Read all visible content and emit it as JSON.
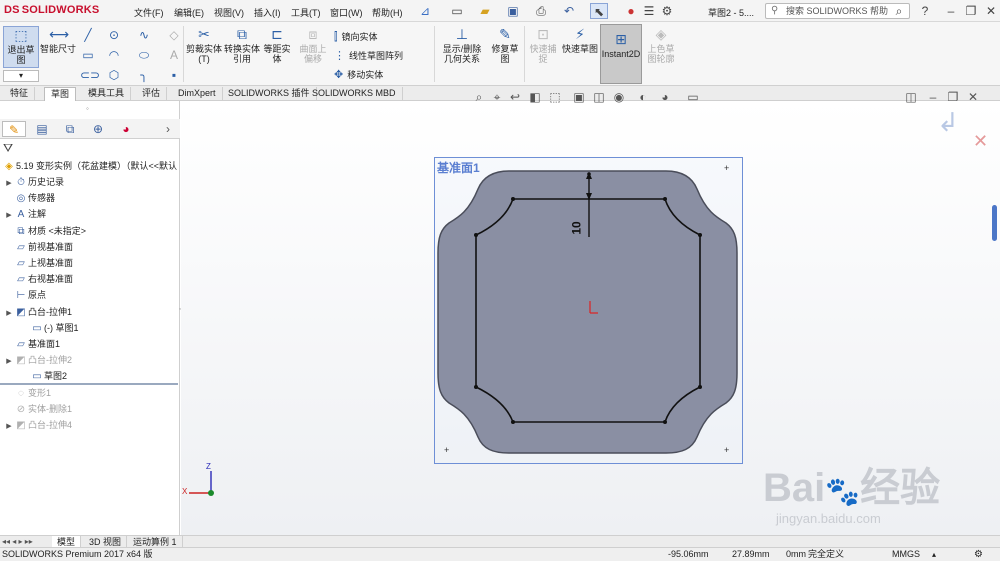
{
  "app": {
    "logo": "SOLIDWORKS",
    "logo_mark": "DS",
    "window_title": "草图2 - 5....",
    "search_placeholder": "搜索 SOLIDWORKS 帮助"
  },
  "menu": [
    "文件(F)",
    "编辑(E)",
    "视图(V)",
    "插入(I)",
    "工具(T)",
    "窗口(W)",
    "帮助(H)"
  ],
  "toolbar": {
    "exit_sketch": "退出草图",
    "smart_dim": "智能尺寸",
    "trim": "剪裁实体(T)",
    "convert": "转换实体引用",
    "offset": "等距实体",
    "surface_offset": "曲面上偏移",
    "mirror": "镜向实体",
    "linear_pattern": "线性草图阵列",
    "move": "移动实体",
    "display_delete": "显示/删除几何关系",
    "repair": "修复草图",
    "quick_snap": "快速捕捉",
    "rapid_sketch": "快速草图",
    "instant2d": "Instant2D",
    "shaded_contours": "上色草图轮廓"
  },
  "tabs": [
    "特征",
    "草图",
    "模具工具",
    "评估",
    "DimXpert",
    "SOLIDWORKS 插件",
    "SOLIDWORKS MBD"
  ],
  "active_tab": "草图",
  "feature_tree": {
    "root": "5.19 变形实例（花盆建模）（默认<<默认",
    "items": [
      {
        "label": "历史记录",
        "icon": "history-icon",
        "arrow": true,
        "indent": 0,
        "grey": false
      },
      {
        "label": "传感器",
        "icon": "sensor-icon",
        "arrow": false,
        "indent": 0,
        "grey": false
      },
      {
        "label": "注解",
        "icon": "annotation-icon",
        "arrow": true,
        "indent": 0,
        "grey": false
      },
      {
        "label": "材质 <未指定>",
        "icon": "material-icon",
        "arrow": false,
        "indent": 0,
        "grey": false
      },
      {
        "label": "前视基准面",
        "icon": "plane-icon",
        "arrow": false,
        "indent": 0,
        "grey": false
      },
      {
        "label": "上视基准面",
        "icon": "plane-icon",
        "arrow": false,
        "indent": 0,
        "grey": false
      },
      {
        "label": "右视基准面",
        "icon": "plane-icon",
        "arrow": false,
        "indent": 0,
        "grey": false
      },
      {
        "label": "原点",
        "icon": "origin-icon",
        "arrow": false,
        "indent": 0,
        "grey": false
      },
      {
        "label": "凸台-拉伸1",
        "icon": "extrude-icon",
        "arrow": true,
        "indent": 0,
        "grey": false
      },
      {
        "label": "(-) 草图1",
        "icon": "sketch-icon",
        "arrow": false,
        "indent": 1,
        "grey": false
      },
      {
        "label": "基准面1",
        "icon": "plane-icon",
        "arrow": false,
        "indent": 0,
        "grey": false
      },
      {
        "label": "凸台-拉伸2",
        "icon": "extrude-icon",
        "arrow": true,
        "indent": 0,
        "grey": true
      },
      {
        "label": "草图2",
        "icon": "sketch-icon",
        "arrow": false,
        "indent": 1,
        "grey": false
      },
      {
        "label": "变形1",
        "icon": "deform-icon",
        "arrow": false,
        "indent": 0,
        "grey": true
      },
      {
        "label": "实体-删除1",
        "icon": "delete-body-icon",
        "arrow": false,
        "indent": 0,
        "grey": true
      },
      {
        "label": "凸台-拉伸4",
        "icon": "extrude-icon",
        "arrow": true,
        "indent": 0,
        "grey": true
      }
    ]
  },
  "viewport": {
    "plane_label": "基准面1",
    "dimension": "10",
    "triad": {
      "x": "X",
      "y": "Y",
      "z": "Z"
    }
  },
  "bottom_tabs": [
    "模型",
    "3D 视图",
    "运动算例 1"
  ],
  "status": {
    "product": "SOLIDWORKS Premium 2017 x64 版",
    "x": "-95.06mm",
    "y": "27.89mm",
    "z": "0mm",
    "state": "完全定义",
    "units": "MMGS"
  },
  "watermark": {
    "main": "Bai",
    "cn": "经验",
    "url": "jingyan.baidu.com"
  },
  "colors": {
    "face": "#8a8fa3",
    "plane_border": "#6e8fd6",
    "sketch_line": "#111111",
    "accent": "#c8102e"
  }
}
